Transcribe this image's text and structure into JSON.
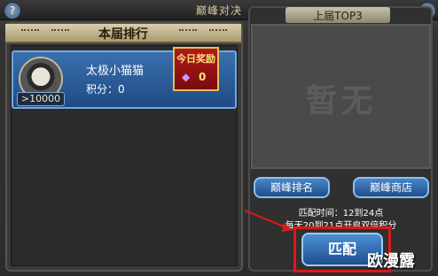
{
  "window": {
    "title": "巅峰对决",
    "close_glyph": "✕",
    "help_glyph": "?"
  },
  "left_panel": {
    "header": "本届排行",
    "entry": {
      "name": "太极小猫猫",
      "score_text": "积分：0",
      "power_text": ">10000",
      "reward": {
        "title": "今日奖励",
        "value": "0"
      }
    }
  },
  "right_panel": {
    "tab_title": "上届TOP3",
    "empty_text": "暂无",
    "rank_button": "巅峰排名",
    "shop_button": "巅峰商店",
    "match_time": "匹配时间：12到24点",
    "notice": "每天20到21点开启双倍积分",
    "match_button": "匹配"
  },
  "watermark": "欧漫露",
  "colors": {
    "accent_red": "#e01818",
    "button_blue": "#2e6bb0",
    "gold": "#ffe27a"
  }
}
